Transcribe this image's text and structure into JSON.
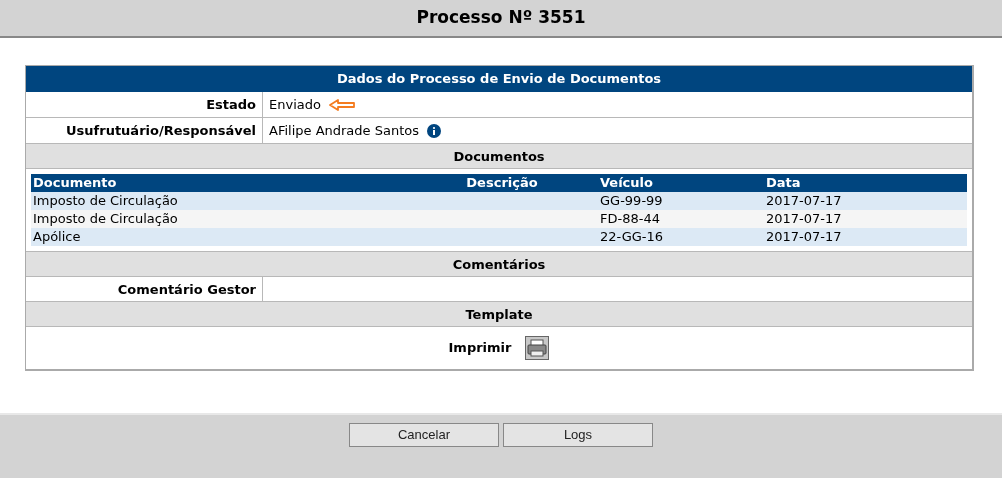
{
  "page": {
    "title": "Processo Nº 3551"
  },
  "panel": {
    "title": "Dados do Processo de Envio de Documentos",
    "fields": [
      {
        "label": "Estado",
        "value": "Enviado",
        "kind": "arrow"
      },
      {
        "label": "Usufrutuário/Responsável",
        "value": "AFilipe Andrade Santos",
        "kind": "info"
      }
    ],
    "documents": {
      "title": "Documentos",
      "columns": [
        "Documento",
        "Descrição",
        "Veículo",
        "Data"
      ],
      "rows": [
        {
          "documento": "Imposto de Circulação",
          "veiculo": "GG-99-99",
          "data": "2017-07-17"
        },
        {
          "documento": "Imposto de Circulação",
          "veiculo": "FD-88-44",
          "data": "2017-07-17"
        },
        {
          "documento": "Apólice",
          "veiculo": "22-GG-16",
          "data": "2017-07-17"
        }
      ]
    },
    "comments": {
      "title": "Comentários",
      "label": "Comentário Gestor"
    },
    "template": {
      "title": "Template",
      "label": "Imprimir"
    }
  },
  "buttons": [
    "Cancelar",
    "Logs"
  ]
}
